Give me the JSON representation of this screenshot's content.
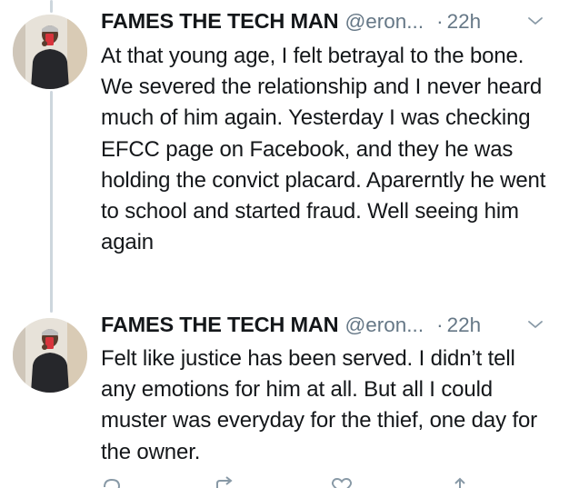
{
  "tweets": [
    {
      "display_name": "FAMES THE TECH MAN",
      "handle": "@eron...",
      "separator": "·",
      "time": "22h",
      "text": "At that young age, I felt betrayal to the bone. We severed the relationship and I never heard much of him again. Yesterday I was checking EFCC page on Facebook, and they he was holding the convict placard. Aparerntly he went to school and started fraud. Well seeing him again"
    },
    {
      "display_name": "FAMES THE TECH MAN",
      "handle": "@eron...",
      "separator": "·",
      "time": "22h",
      "text": "Felt like justice has been served. I didn’t tell any emotions for him at all. But all I could muster was everyday for the thief, one day for the owner."
    }
  ],
  "icons": {
    "caret": "chevron-down-icon",
    "reply": "reply-icon",
    "retweet": "retweet-icon",
    "like": "heart-icon",
    "share": "share-icon"
  },
  "colors": {
    "text": "#14171a",
    "secondary": "#657786",
    "thread_line": "#cdd6dd"
  }
}
